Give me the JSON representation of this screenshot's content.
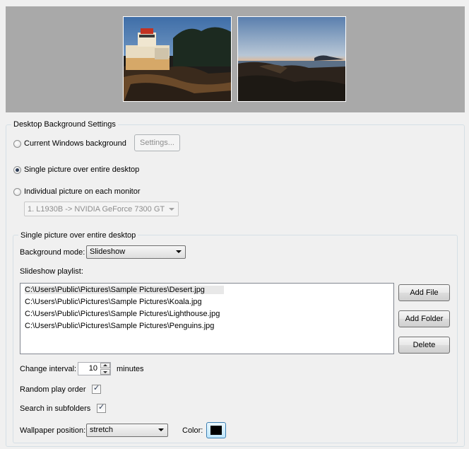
{
  "preview": {
    "monitors": [
      {
        "name": "monitor-1",
        "image": "lighthouse-left-half"
      },
      {
        "name": "monitor-2",
        "image": "lighthouse-right-half"
      }
    ]
  },
  "settings_group": {
    "title": "Desktop Background Settings",
    "radio_current": "Current Windows background",
    "settings_button": "Settings...",
    "radio_single": "Single picture over entire desktop",
    "radio_individual": "Individual picture on each monitor",
    "monitor_select": "1. L1930B -> NVIDIA GeForce 7300 GT",
    "selected_radio": "single"
  },
  "single_group": {
    "title": "Single picture over entire desktop",
    "background_mode_label": "Background mode:",
    "background_mode_value": "Slideshow",
    "playlist_label": "Slideshow playlist:",
    "playlist": [
      "C:\\Users\\Public\\Pictures\\Sample Pictures\\Desert.jpg",
      "C:\\Users\\Public\\Pictures\\Sample Pictures\\Koala.jpg",
      "C:\\Users\\Public\\Pictures\\Sample Pictures\\Lighthouse.jpg",
      "C:\\Users\\Public\\Pictures\\Sample Pictures\\Penguins.jpg"
    ],
    "add_file": "Add File",
    "add_folder": "Add Folder",
    "delete": "Delete",
    "change_interval_label": "Change interval:",
    "change_interval_value": "10",
    "interval_unit": "minutes",
    "random_label": "Random play order",
    "random_checked": true,
    "subfolders_label": "Search in subfolders",
    "subfolders_checked": true,
    "wallpaper_position_label": "Wallpaper position:",
    "wallpaper_position_value": "stretch",
    "color_label": "Color:",
    "color_value": "#000000"
  }
}
